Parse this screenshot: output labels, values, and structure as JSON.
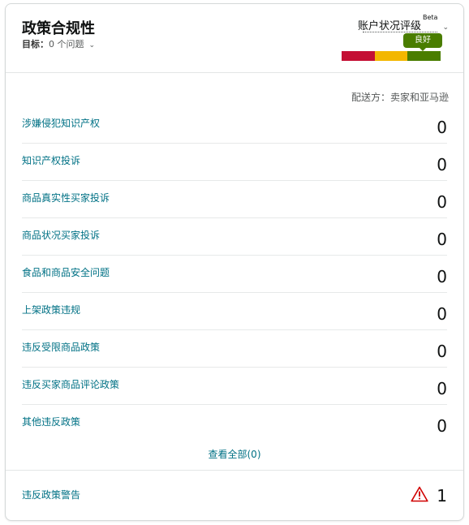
{
  "header": {
    "title": "政策合规性",
    "target_label": "目标：",
    "target_value": "0 个问题",
    "target_chevron_icon": "chevron-down-icon"
  },
  "account_health": {
    "label": "账户状况评级",
    "beta": "Beta",
    "chevron_icon": "chevron-down-icon",
    "status": "良好",
    "status_color": "#4a7d00",
    "bar_colors": [
      "#c40f34",
      "#f3b700",
      "#4a7d00"
    ]
  },
  "fulfillment": "配送方：卖家和亚马逊",
  "rows": [
    {
      "label": "涉嫌侵犯知识产权",
      "count": "0"
    },
    {
      "label": "知识产权投诉",
      "count": "0"
    },
    {
      "label": "商品真实性买家投诉",
      "count": "0"
    },
    {
      "label": "商品状况买家投诉",
      "count": "0"
    },
    {
      "label": "食品和商品安全问题",
      "count": "0"
    },
    {
      "label": "上架政策违规",
      "count": "0"
    },
    {
      "label": "违反受限商品政策",
      "count": "0"
    },
    {
      "label": "违反买家商品评论政策",
      "count": "0"
    },
    {
      "label": "其他违反政策",
      "count": "0"
    }
  ],
  "view_all": "查看全部(0)",
  "warnings": {
    "label": "违反政策警告",
    "count": "1",
    "icon": "warning-icon",
    "icon_color": "#d00000"
  },
  "colors": {
    "link": "#007185",
    "text": "#0f1111",
    "muted": "#565959"
  }
}
